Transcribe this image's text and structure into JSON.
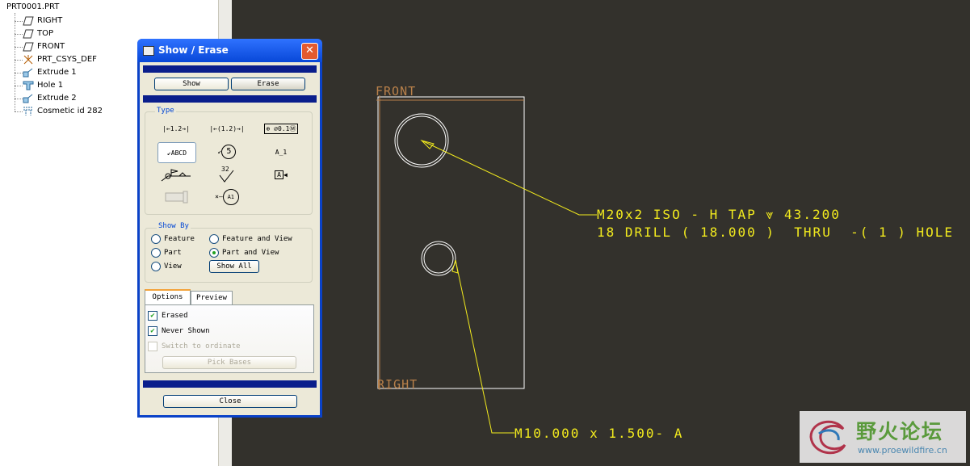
{
  "model_tree": {
    "root": "PRT0001.PRT",
    "items": [
      {
        "label": "RIGHT",
        "icon": "datum-plane-icon"
      },
      {
        "label": "TOP",
        "icon": "datum-plane-icon"
      },
      {
        "label": "FRONT",
        "icon": "datum-plane-icon"
      },
      {
        "label": "PRT_CSYS_DEF",
        "icon": "csys-icon"
      },
      {
        "label": "Extrude 1",
        "icon": "extrude-icon"
      },
      {
        "label": "Hole 1",
        "icon": "hole-icon"
      },
      {
        "label": "Extrude 2",
        "icon": "extrude-icon"
      },
      {
        "label": "Cosmetic id 282",
        "icon": "cosmetic-thread-icon"
      }
    ]
  },
  "dialog": {
    "title": "Show / Erase",
    "show_label": "Show",
    "erase_label": "Erase",
    "type_label": "Type",
    "type_buttons": {
      "dimension": "1.2",
      "ref_dimension": "(1.2)",
      "gtol": "0.1",
      "note": "ABCD",
      "balloon": "5",
      "axis": "A_1",
      "weld": "weld-symbol",
      "surface_finish": "32",
      "datum": "A",
      "cosmetic": "cosmetic-feature",
      "datum_target": "A1"
    },
    "showby_label": "Show By",
    "showby_options": [
      "Feature",
      "Feature and View",
      "Part",
      "Part and View",
      "View"
    ],
    "showby_selected": "Part and View",
    "show_all_label": "Show All",
    "tabs": [
      "Options",
      "Preview"
    ],
    "active_tab": "Options",
    "options": [
      {
        "label": "Erased",
        "checked": true,
        "enabled": true
      },
      {
        "label": "Never Shown",
        "checked": true,
        "enabled": true
      },
      {
        "label": "Switch to ordinate",
        "checked": false,
        "enabled": false
      }
    ],
    "pick_bases_label": "Pick Bases",
    "close_label": "Close"
  },
  "graphics": {
    "datum_front": "FRONT",
    "datum_right": "RIGHT",
    "hole_note_line1": "M20x2 ISO - H TAP ⩔ 43.200",
    "hole_note_line2": "18 DRILL ( 18.000 )  THRU  -( 1 ) HOLE",
    "thread_note": "M10.000 x 1.500- A",
    "colors": {
      "background": "#33312c",
      "annotation": "#f2ea1e",
      "geometry": "#ffffff",
      "datum": "#b8804a"
    }
  },
  "watermark": {
    "name": "野火论坛",
    "url": "www.proewildfire.cn"
  }
}
